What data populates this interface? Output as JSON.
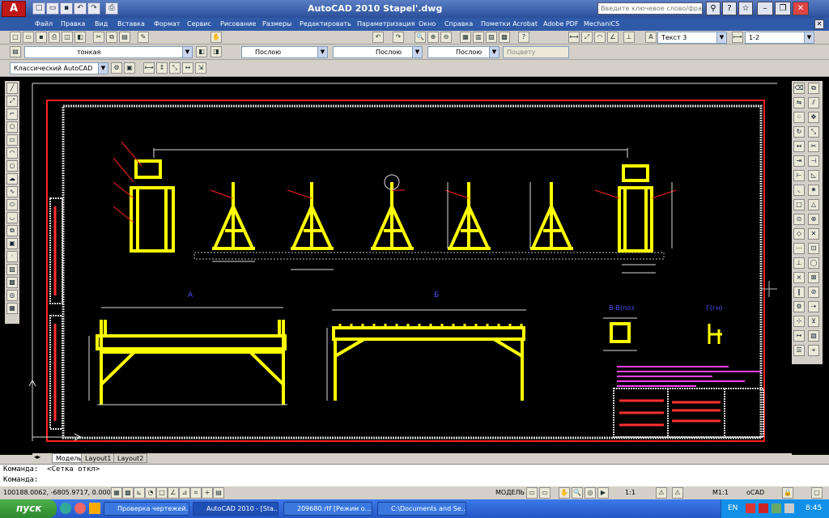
{
  "window": {
    "app_button": "A",
    "title": "AutoCAD 2010    Stapel'.dwg",
    "search_placeholder": "Введите ключевое слово/фразу",
    "buttons": {
      "minimize": "–",
      "restore": "❐",
      "close": "✕"
    }
  },
  "menu": [
    "Файл",
    "Правка",
    "Вид",
    "Вставка",
    "Формат",
    "Сервис",
    "Рисование",
    "Размеры",
    "Редактировать",
    "Параметризация",
    "Окно",
    "Справка",
    "Пометки Acrobat",
    "Adobe PDF",
    "MechaniCS"
  ],
  "toolbar": {
    "layer_value": "тонкая",
    "color_value": "Послою",
    "linetype_value": "Послою",
    "lineweight_value": "Послою",
    "plotstyle_value": "Поцвету",
    "text_style": "Текст 3",
    "dim_style": "1-2",
    "workspace": "Классический AutoCAD"
  },
  "tabs": [
    "Модель",
    "Layout1",
    "Layout2"
  ],
  "command": {
    "line1": "Команда:  <Сетка откл>",
    "line2": "Команда:"
  },
  "status": {
    "coords": "100188.0062, -6805.9717, 0.0000",
    "model": "МОДЕЛЬ",
    "scale": "1:1",
    "annot": "М1:1",
    "workspace": "оCAD"
  },
  "taskbar": {
    "start": "пуск",
    "tasks": [
      "Проверка чертежей...",
      "AutoCAD 2010 - [Sta...",
      "209680.rtf [Режим о...",
      "C:\\Documents and Se..."
    ],
    "lang": "EN",
    "time": "8:45"
  },
  "drawing": {
    "section_labels": [
      "А",
      "Б",
      "В-В(поз",
      "Г(гн)"
    ]
  },
  "colors": {
    "accent_title": "#2a4f9a",
    "drawing_yellow": "#ffff00",
    "drawing_red": "#ff2020",
    "drawing_white": "#ffffff",
    "drawing_blue": "#5050ff"
  }
}
